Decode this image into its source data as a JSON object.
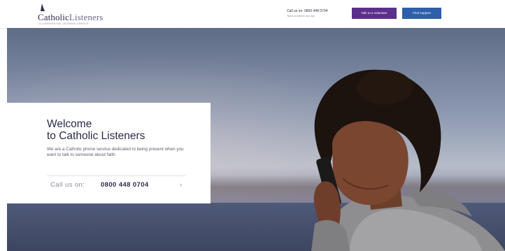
{
  "header": {
    "logo": {
      "name_bold": "Catholic",
      "name_light": "Listeners",
      "tagline": "A CONFIDENTIAL LISTENING SERVICE"
    },
    "call": {
      "line1": "Call us on: 0800 448 0704",
      "line2": "Talk to a listener any day"
    },
    "buttons": {
      "primary": "Talk to a volunteer",
      "secondary": "Find support"
    }
  },
  "hero": {
    "title_line1": "Welcome",
    "title_line2": "to Catholic Listeners",
    "description": "We are a Catholic phone service dedicated to being present when you want to talk to someone about faith.",
    "call_label": "Call us on:",
    "call_number": "0800 448 0704",
    "arrow": "›"
  },
  "colors": {
    "brand_navy": "#2b2d4a",
    "purple_button": "#5b2f8c",
    "blue_button": "#2e5fa8"
  },
  "icons": {
    "logo_mark": "church-steeple-icon",
    "arrow": "chevron-right-icon"
  }
}
